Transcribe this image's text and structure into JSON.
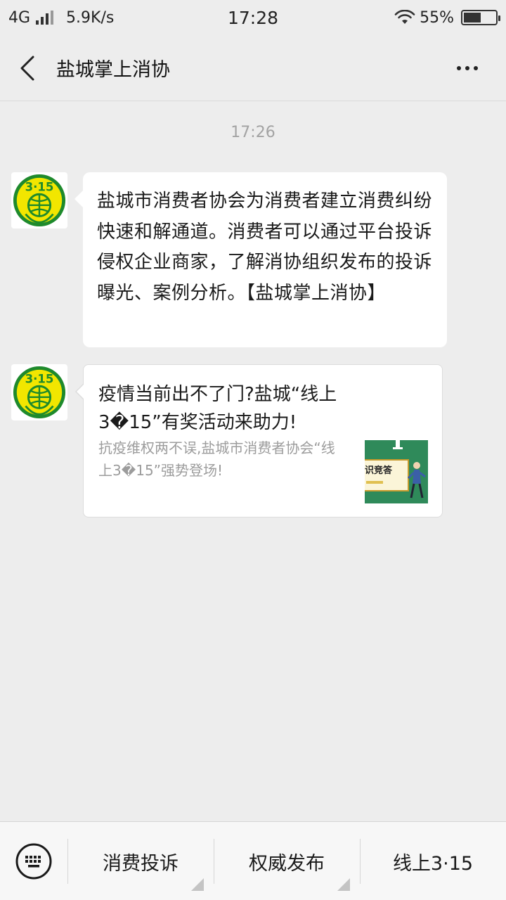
{
  "status_bar": {
    "network": "4G",
    "speed": "5.9K/s",
    "time": "17:28",
    "battery": "55%",
    "battery_level": 0.55,
    "icons": [
      "signal-icon",
      "wifi-icon",
      "battery-icon"
    ]
  },
  "header": {
    "title": "盐城掌上消协",
    "icons": [
      "back-arrow-icon",
      "more-icon"
    ]
  },
  "chat": {
    "timestamp": "17:26",
    "avatar_icon": "consumer-315-logo",
    "message_text": "盐城市消费者协会为消费者建立消费纠纷快速和解通道。消费者可以通过平台投诉侵权企业商家，了解消协组织发布的投诉曝光、案例分析。【盐城掌上消协】",
    "article": {
      "title": "疫情当前出不了门?盐城“线上3�15”有奖活动来助力!",
      "description": "抗疫维权两不误,盐城市消费者协会“线上3�15”强势登场!",
      "thumbnail_icon": "article-thumbnail"
    }
  },
  "bottom_menu": {
    "keyboard_icon": "keyboard-icon",
    "items": [
      {
        "label": "消费投诉",
        "has_submenu": true
      },
      {
        "label": "权威发布",
        "has_submenu": true
      },
      {
        "label": "线上3·15",
        "has_submenu": false
      }
    ]
  },
  "colors": {
    "background": "#ededed",
    "bubble": "#ffffff",
    "logo_green": "#1e8a2c",
    "logo_yellow": "#f2e600",
    "thumb_green": "#2f8a5a"
  }
}
